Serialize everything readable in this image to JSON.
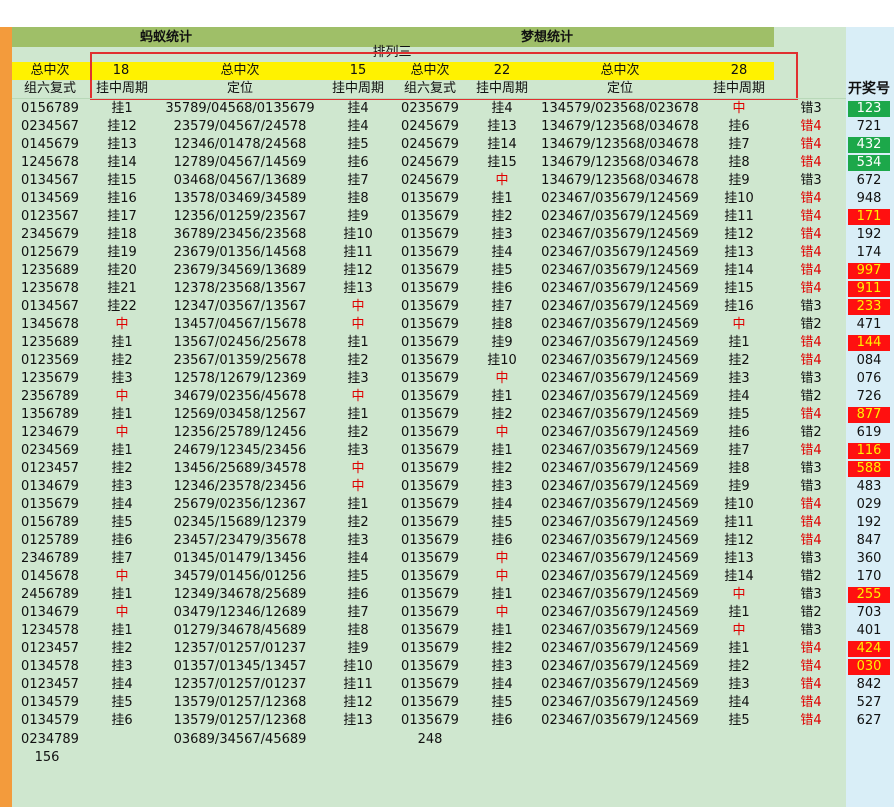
{
  "headers": {
    "group1": "蚂蚁统计",
    "group2": "梦想统计",
    "subtitle": "排列三",
    "h3": [
      "总中次",
      "18",
      "总中次",
      "15",
      "总中次",
      "22",
      "总中次",
      "28"
    ],
    "h4": [
      "组六复式",
      "挂中周期",
      "定位",
      "挂中周期",
      "组六复式",
      "挂中周期",
      "定位",
      "挂中周期"
    ],
    "prize": "开奖号"
  },
  "rows": [
    {
      "c1": "0156789",
      "c2": "挂1",
      "c3": "35789/04568/0135679",
      "c4": "挂4",
      "c5": "0235679",
      "c6": "挂4",
      "c7": "134579/023568/023678",
      "c8": "中",
      "c9": "错3",
      "win": "123",
      "ws": "green"
    },
    {
      "c1": "0234567",
      "c2": "挂12",
      "c3": "23579/04567/24578",
      "c4": "挂4",
      "c5": "0245679",
      "c6": "挂13",
      "c7": "134679/123568/034678",
      "c8": "挂6",
      "c9": "错4",
      "win": "721",
      "ws": "plain"
    },
    {
      "c1": "0145679",
      "c2": "挂13",
      "c3": "12346/01478/24568",
      "c4": "挂5",
      "c5": "0245679",
      "c6": "挂14",
      "c7": "134679/123568/034678",
      "c8": "挂7",
      "c9": "错4",
      "win": "432",
      "ws": "green"
    },
    {
      "c1": "1245678",
      "c2": "挂14",
      "c3": "12789/04567/14569",
      "c4": "挂6",
      "c5": "0245679",
      "c6": "挂15",
      "c7": "134679/123568/034678",
      "c8": "挂8",
      "c9": "错4",
      "win": "534",
      "ws": "green"
    },
    {
      "c1": "0134567",
      "c2": "挂15",
      "c3": "03468/04567/13689",
      "c4": "挂7",
      "c5": "0245679",
      "c6": "中",
      "c7": "134679/123568/034678",
      "c8": "挂9",
      "c9": "错3",
      "win": "672",
      "ws": "plain"
    },
    {
      "c1": "0134569",
      "c2": "挂16",
      "c3": "13578/03469/34589",
      "c4": "挂8",
      "c5": "0135679",
      "c6": "挂1",
      "c7": "023467/035679/124569",
      "c8": "挂10",
      "c9": "错4",
      "win": "948",
      "ws": "plain"
    },
    {
      "c1": "0123567",
      "c2": "挂17",
      "c3": "12356/01259/23567",
      "c4": "挂9",
      "c5": "0135679",
      "c6": "挂2",
      "c7": "023467/035679/124569",
      "c8": "挂11",
      "c9": "错4",
      "win": "171",
      "ws": "red"
    },
    {
      "c1": "2345679",
      "c2": "挂18",
      "c3": "36789/23456/23568",
      "c4": "挂10",
      "c5": "0135679",
      "c6": "挂3",
      "c7": "023467/035679/124569",
      "c8": "挂12",
      "c9": "错4",
      "win": "192",
      "ws": "plain"
    },
    {
      "c1": "0125679",
      "c2": "挂19",
      "c3": "23679/01356/14568",
      "c4": "挂11",
      "c5": "0135679",
      "c6": "挂4",
      "c7": "023467/035679/124569",
      "c8": "挂13",
      "c9": "错4",
      "win": "174",
      "ws": "plain"
    },
    {
      "c1": "1235689",
      "c2": "挂20",
      "c3": "23679/34569/13689",
      "c4": "挂12",
      "c5": "0135679",
      "c6": "挂5",
      "c7": "023467/035679/124569",
      "c8": "挂14",
      "c9": "错4",
      "win": "997",
      "ws": "red"
    },
    {
      "c1": "1235678",
      "c2": "挂21",
      "c3": "12378/23568/13567",
      "c4": "挂13",
      "c5": "0135679",
      "c6": "挂6",
      "c7": "023467/035679/124569",
      "c8": "挂15",
      "c9": "错4",
      "win": "911",
      "ws": "red"
    },
    {
      "c1": "0134567",
      "c2": "挂22",
      "c3": "12347/03567/13567",
      "c4": "中",
      "c5": "0135679",
      "c6": "挂7",
      "c7": "023467/035679/124569",
      "c8": "挂16",
      "c9": "错3",
      "win": "233",
      "ws": "red"
    },
    {
      "c1": "1345678",
      "c2": "中",
      "c3": "13457/04567/15678",
      "c4": "中",
      "c5": "0135679",
      "c6": "挂8",
      "c7": "023467/035679/124569",
      "c8": "中",
      "c9": "错2",
      "win": "471",
      "ws": "plain"
    },
    {
      "c1": "1235689",
      "c2": "挂1",
      "c3": "13567/02456/25678",
      "c4": "挂1",
      "c5": "0135679",
      "c6": "挂9",
      "c7": "023467/035679/124569",
      "c8": "挂1",
      "c9": "错4",
      "win": "144",
      "ws": "red"
    },
    {
      "c1": "0123569",
      "c2": "挂2",
      "c3": "23567/01359/25678",
      "c4": "挂2",
      "c5": "0135679",
      "c6": "挂10",
      "c7": "023467/035679/124569",
      "c8": "挂2",
      "c9": "错4",
      "win": "084",
      "ws": "plain"
    },
    {
      "c1": "1235679",
      "c2": "挂3",
      "c3": "12578/12679/12369",
      "c4": "挂3",
      "c5": "0135679",
      "c6": "中",
      "c7": "023467/035679/124569",
      "c8": "挂3",
      "c9": "错3",
      "win": "076",
      "ws": "plain"
    },
    {
      "c1": "2356789",
      "c2": "中",
      "c3": "34679/02356/45678",
      "c4": "中",
      "c5": "0135679",
      "c6": "挂1",
      "c7": "023467/035679/124569",
      "c8": "挂4",
      "c9": "错2",
      "win": "726",
      "ws": "plain"
    },
    {
      "c1": "1356789",
      "c2": "挂1",
      "c3": "12569/03458/12567",
      "c4": "挂1",
      "c5": "0135679",
      "c6": "挂2",
      "c7": "023467/035679/124569",
      "c8": "挂5",
      "c9": "错4",
      "win": "877",
      "ws": "red"
    },
    {
      "c1": "1234679",
      "c2": "中",
      "c3": "12356/25789/12456",
      "c4": "挂2",
      "c5": "0135679",
      "c6": "中",
      "c7": "023467/035679/124569",
      "c8": "挂6",
      "c9": "错2",
      "win": "619",
      "ws": "plain"
    },
    {
      "c1": "0234569",
      "c2": "挂1",
      "c3": "24679/12345/23456",
      "c4": "挂3",
      "c5": "0135679",
      "c6": "挂1",
      "c7": "023467/035679/124569",
      "c8": "挂7",
      "c9": "错4",
      "win": "116",
      "ws": "red"
    },
    {
      "c1": "0123457",
      "c2": "挂2",
      "c3": "13456/25689/34578",
      "c4": "中",
      "c5": "0135679",
      "c6": "挂2",
      "c7": "023467/035679/124569",
      "c8": "挂8",
      "c9": "错3",
      "win": "588",
      "ws": "red"
    },
    {
      "c1": "0134679",
      "c2": "挂3",
      "c3": "12346/23578/23456",
      "c4": "中",
      "c5": "0135679",
      "c6": "挂3",
      "c7": "023467/035679/124569",
      "c8": "挂9",
      "c9": "错3",
      "win": "483",
      "ws": "plain"
    },
    {
      "c1": "0135679",
      "c2": "挂4",
      "c3": "25679/02356/12367",
      "c4": "挂1",
      "c5": "0135679",
      "c6": "挂4",
      "c7": "023467/035679/124569",
      "c8": "挂10",
      "c9": "错4",
      "win": "029",
      "ws": "plain"
    },
    {
      "c1": "0156789",
      "c2": "挂5",
      "c3": "02345/15689/12379",
      "c4": "挂2",
      "c5": "0135679",
      "c6": "挂5",
      "c7": "023467/035679/124569",
      "c8": "挂11",
      "c9": "错4",
      "win": "192",
      "ws": "plain"
    },
    {
      "c1": "0125789",
      "c2": "挂6",
      "c3": "23457/23479/35678",
      "c4": "挂3",
      "c5": "0135679",
      "c6": "挂6",
      "c7": "023467/035679/124569",
      "c8": "挂12",
      "c9": "错4",
      "win": "847",
      "ws": "plain"
    },
    {
      "c1": "2346789",
      "c2": "挂7",
      "c3": "01345/01479/13456",
      "c4": "挂4",
      "c5": "0135679",
      "c6": "中",
      "c7": "023467/035679/124569",
      "c8": "挂13",
      "c9": "错3",
      "win": "360",
      "ws": "plain"
    },
    {
      "c1": "0145678",
      "c2": "中",
      "c3": "34579/01456/01256",
      "c4": "挂5",
      "c5": "0135679",
      "c6": "中",
      "c7": "023467/035679/124569",
      "c8": "挂14",
      "c9": "错2",
      "win": "170",
      "ws": "plain"
    },
    {
      "c1": "2456789",
      "c2": "挂1",
      "c3": "12349/34678/25689",
      "c4": "挂6",
      "c5": "0135679",
      "c6": "挂1",
      "c7": "023467/035679/124569",
      "c8": "中",
      "c9": "错3",
      "win": "255",
      "ws": "red"
    },
    {
      "c1": "0134679",
      "c2": "中",
      "c3": "03479/12346/12689",
      "c4": "挂7",
      "c5": "0135679",
      "c6": "中",
      "c7": "023467/035679/124569",
      "c8": "挂1",
      "c9": "错2",
      "win": "703",
      "ws": "plain"
    },
    {
      "c1": "1234578",
      "c2": "挂1",
      "c3": "01279/34678/45689",
      "c4": "挂8",
      "c5": "0135679",
      "c6": "挂1",
      "c7": "023467/035679/124569",
      "c8": "中",
      "c9": "错3",
      "win": "401",
      "ws": "plain"
    },
    {
      "c1": "0123457",
      "c2": "挂2",
      "c3": "12357/01257/01237",
      "c4": "挂9",
      "c5": "0135679",
      "c6": "挂2",
      "c7": "023467/035679/124569",
      "c8": "挂1",
      "c9": "错4",
      "win": "424",
      "ws": "red"
    },
    {
      "c1": "0134578",
      "c2": "挂3",
      "c3": "01357/01345/13457",
      "c4": "挂10",
      "c5": "0135679",
      "c6": "挂3",
      "c7": "023467/035679/124569",
      "c8": "挂2",
      "c9": "错4",
      "win": "030",
      "ws": "red"
    },
    {
      "c1": "0123457",
      "c2": "挂4",
      "c3": "12357/01257/01237",
      "c4": "挂11",
      "c5": "0135679",
      "c6": "挂4",
      "c7": "023467/035679/124569",
      "c8": "挂3",
      "c9": "错4",
      "win": "842",
      "ws": "plain"
    },
    {
      "c1": "0134579",
      "c2": "挂5",
      "c3": "13579/01257/12368",
      "c4": "挂12",
      "c5": "0135679",
      "c6": "挂5",
      "c7": "023467/035679/124569",
      "c8": "挂4",
      "c9": "错4",
      "win": "527",
      "ws": "plain"
    },
    {
      "c1": "0134579",
      "c2": "挂6",
      "c3": "13579/01257/12368",
      "c4": "挂13",
      "c5": "0135679",
      "c6": "挂6",
      "c7": "023467/035679/124569",
      "c8": "挂5",
      "c9": "错4",
      "win": "627",
      "ws": "plain"
    }
  ],
  "tail": {
    "c1": "0234789",
    "c3": "03689/34567/45689",
    "c5": "248",
    "extra": "156"
  },
  "colors": {
    "header_green": "#9fbf68",
    "header_yellow": "#fff200",
    "sheet_green": "#cfe7cf",
    "hit_red": "#e00000",
    "win_green": "#1ca84a",
    "win_red": "#ff1010"
  }
}
